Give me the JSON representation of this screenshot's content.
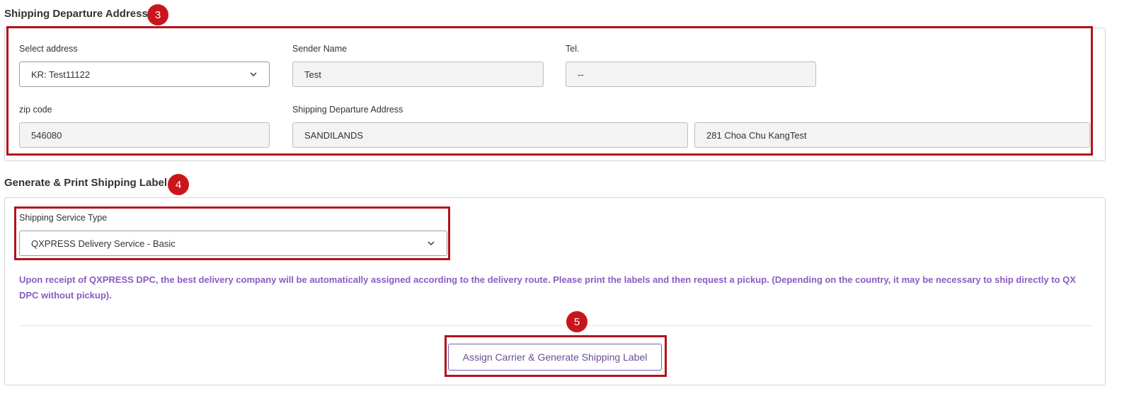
{
  "departure": {
    "title": "Shipping Departure Address",
    "badge": "3",
    "select_address": {
      "label": "Select address",
      "value": "KR: Test11122"
    },
    "sender_name": {
      "label": "Sender Name",
      "value": "Test"
    },
    "tel": {
      "label": "Tel.",
      "value": "--"
    },
    "zip_code": {
      "label": "zip code",
      "value": "546080"
    },
    "address": {
      "label": "Shipping Departure Address",
      "line1": "SANDILANDS",
      "line2": "281 Choa Chu KangTest"
    }
  },
  "label_section": {
    "title": "Generate & Print Shipping Label",
    "badge": "4",
    "service_type": {
      "label": "Shipping Service Type",
      "value": "QXPRESS Delivery Service - Basic"
    },
    "notice": "Upon receipt of QXPRESS DPC, the best delivery company will be automatically assigned according to the delivery route. Please print the labels and then request a pickup. (Depending on the country, it may be necessary to ship directly to QX DPC without pickup).",
    "action_badge": "5",
    "assign_button": "Assign Carrier & Generate Shipping Label"
  },
  "colors": {
    "highlight": "#b3121b",
    "badge": "#c8161d",
    "notice_text": "#8a5cc2",
    "button_text": "#6b4c9a"
  }
}
